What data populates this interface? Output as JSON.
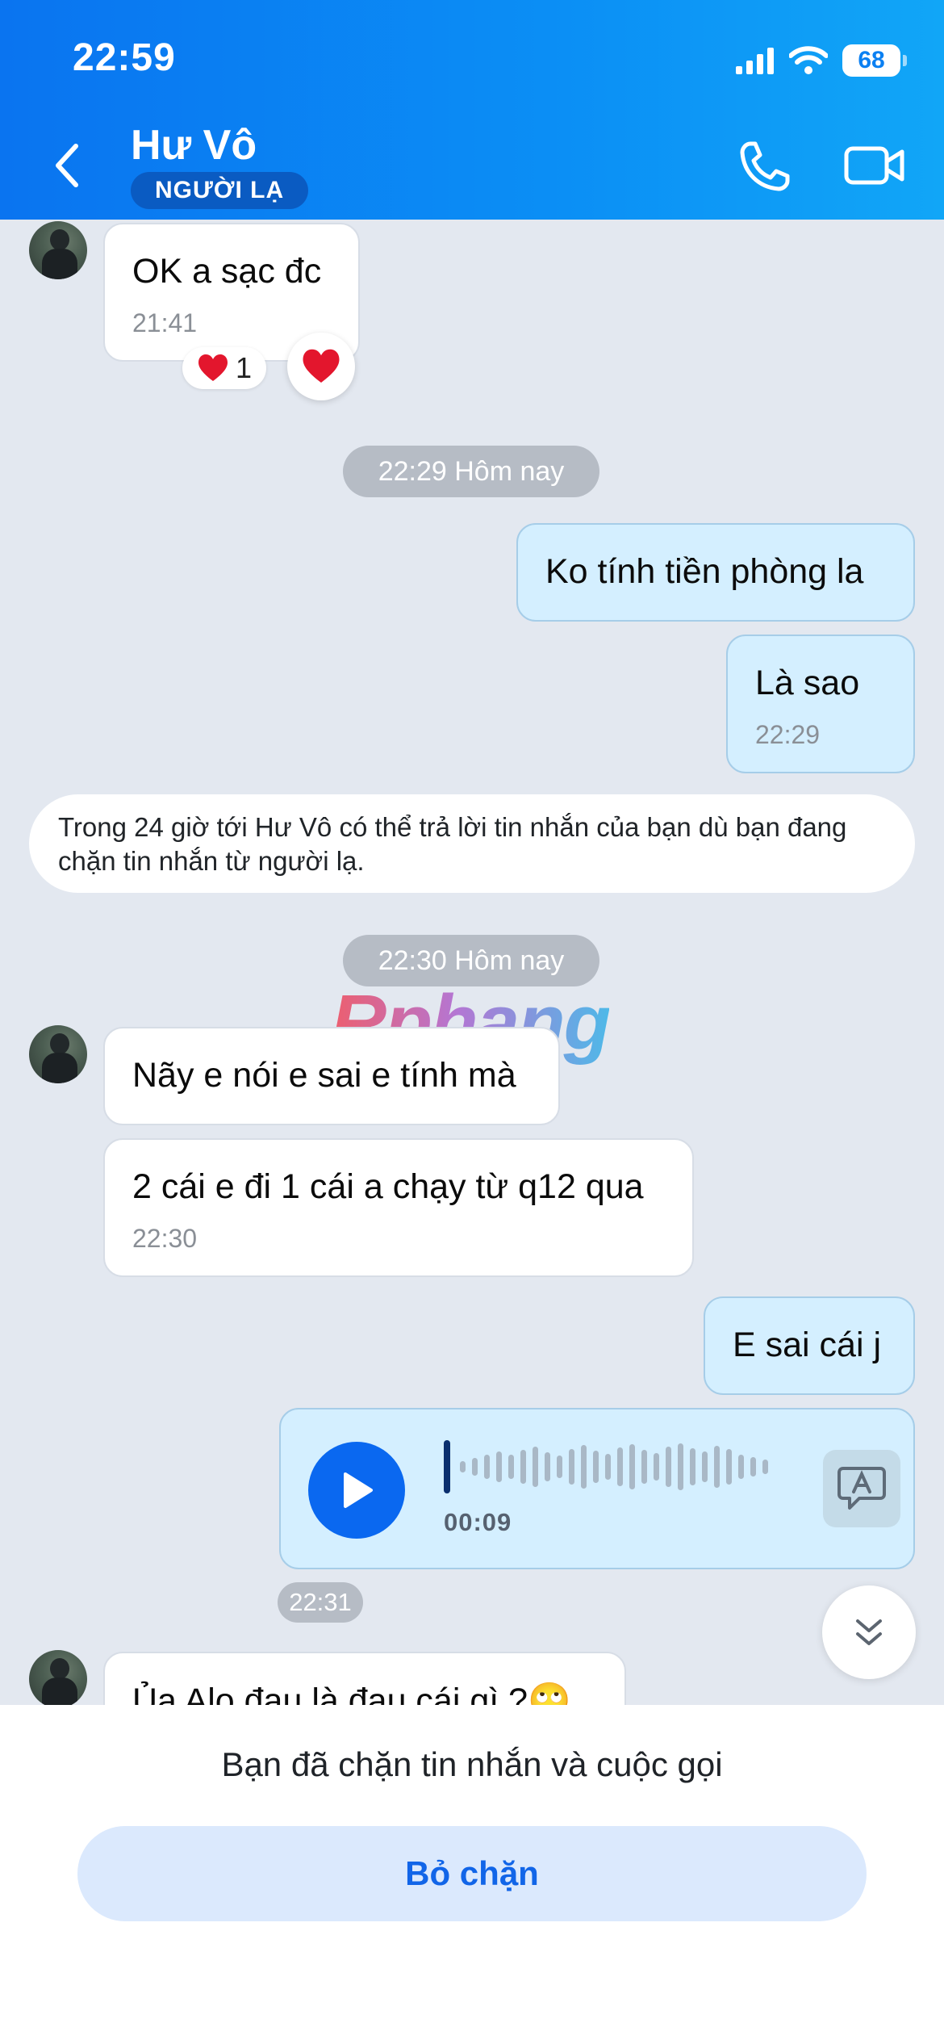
{
  "status_bar": {
    "time": "22:59",
    "battery": "68",
    "signal_icon": "cellular-signal-icon",
    "wifi_icon": "wifi-icon"
  },
  "header": {
    "title": "Hư Vô",
    "badge": "NGƯỜI LẠ",
    "back_icon": "chevron-left-icon",
    "call_icon": "phone-icon",
    "video_icon": "video-camera-icon"
  },
  "messages": {
    "m1": {
      "text": "OK a sạc đc",
      "time": "21:41",
      "reaction_count": "1",
      "reaction_icon": "heart-icon"
    },
    "sep1": "22:29 Hôm nay",
    "m2": {
      "text": "Ko tính tiền phòng la"
    },
    "m3": {
      "text": "Là sao",
      "time": "22:29"
    },
    "system_note": "Trong 24 giờ tới Hư Vô có thể trả lời tin nhắn của bạn dù bạn đang chặn tin nhắn từ người lạ.",
    "sep2": "22:30 Hôm nay",
    "m4": {
      "text": "Nãy e nói e sai e tính mà"
    },
    "m5": {
      "text": "2 cái e đi 1 cái a chạy từ q12 qua",
      "time": "22:30"
    },
    "m6": {
      "text": "E sai cái j"
    },
    "voice": {
      "duration": "00:09",
      "time": "22:31"
    },
    "m7": {
      "text": "Ủa Alo đau là đau cái gì ?🙄"
    }
  },
  "watermark": "Rphang",
  "footer": {
    "blocked_text": "Bạn đã chặn tin nhắn và cuộc gọi",
    "unblock_label": "Bỏ chặn"
  },
  "colors": {
    "header_start": "#0a74f0",
    "header_end": "#11a6f7",
    "outgoing_bubble": "#d4efff",
    "accent": "#0a68f0"
  }
}
